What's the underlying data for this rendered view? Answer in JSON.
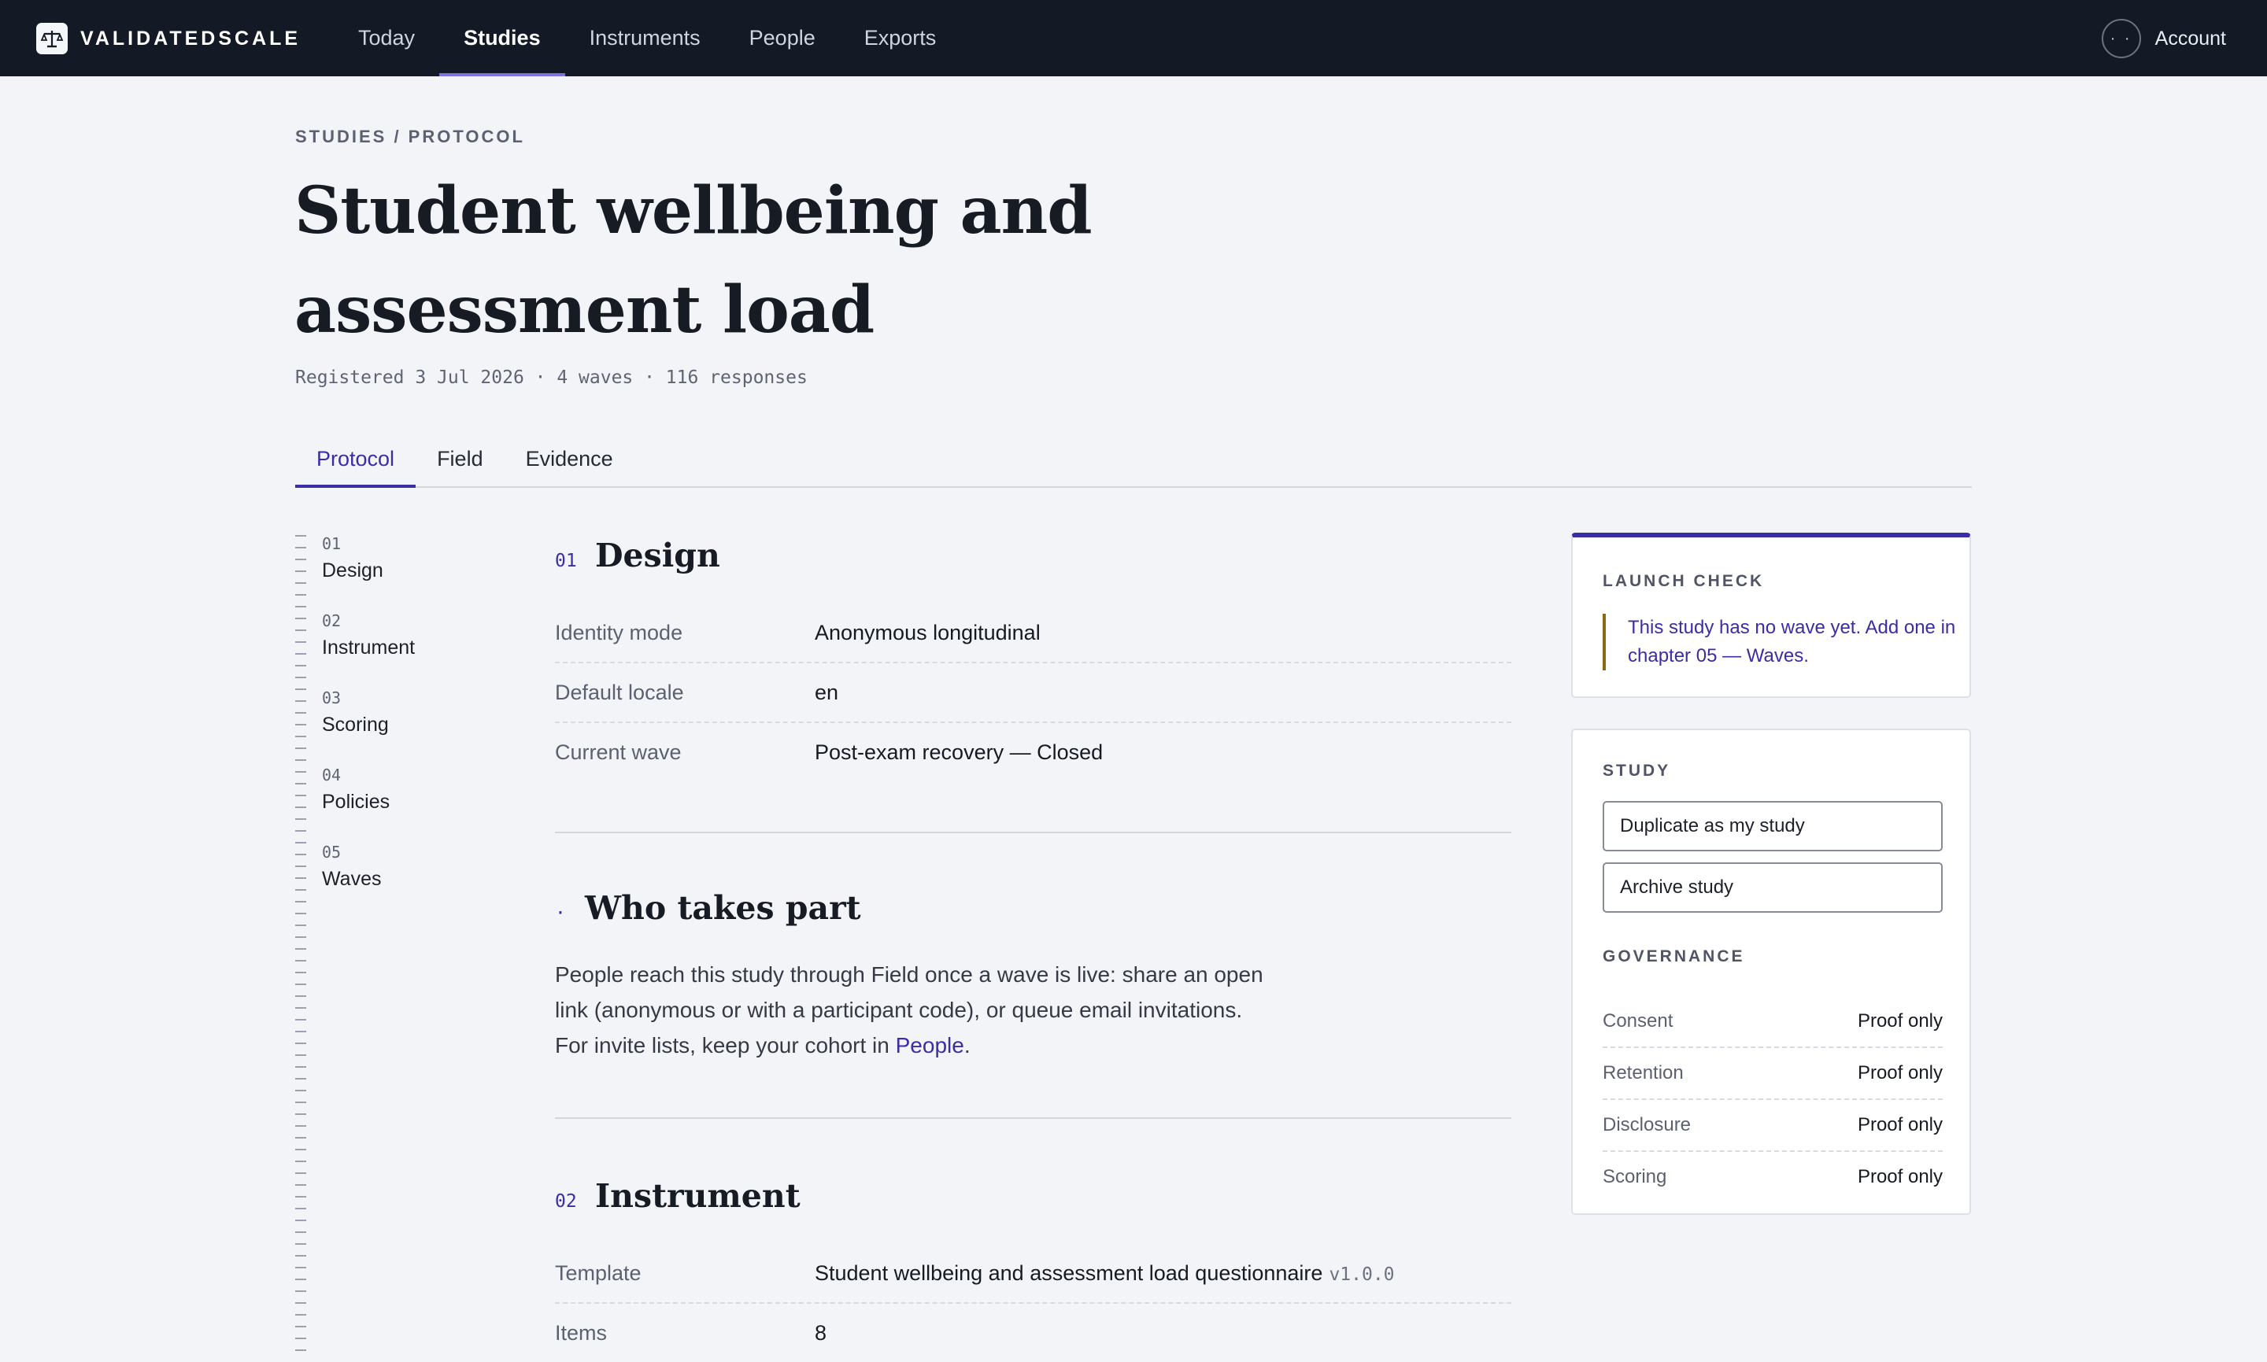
{
  "brand": {
    "name": "VALIDATEDSCALE",
    "logo_icon": "scales-icon"
  },
  "nav": [
    {
      "label": "Today",
      "active": false
    },
    {
      "label": "Studies",
      "active": true
    },
    {
      "label": "Instruments",
      "active": false
    },
    {
      "label": "People",
      "active": false
    },
    {
      "label": "Exports",
      "active": false
    }
  ],
  "account": {
    "label": "Account",
    "avatar_glyph": "· ·"
  },
  "breadcrumb": "STUDIES / PROTOCOL",
  "title": "Student wellbeing and assessment load",
  "meta": "Registered 3 Jul 2026 · 4 waves · 116 responses",
  "tabs": [
    {
      "label": "Protocol",
      "active": true
    },
    {
      "label": "Field",
      "active": false
    },
    {
      "label": "Evidence",
      "active": false
    }
  ],
  "chapters": [
    {
      "num": "01",
      "label": "Design"
    },
    {
      "num": "02",
      "label": "Instrument"
    },
    {
      "num": "03",
      "label": "Scoring"
    },
    {
      "num": "04",
      "label": "Policies"
    },
    {
      "num": "05",
      "label": "Waves"
    }
  ],
  "design": {
    "num": "01",
    "title": "Design",
    "rows": [
      {
        "key": "Identity mode",
        "value": "Anonymous longitudinal"
      },
      {
        "key": "Default locale",
        "value": "en"
      },
      {
        "key": "Current wave",
        "value": "Post-exam recovery — Closed"
      }
    ]
  },
  "who": {
    "marker": "·",
    "title": "Who takes part",
    "text_before": "People reach this study through Field once a wave is live: share an open link (anonymous or with a participant code), or queue email invitations. For invite lists, keep your cohort in ",
    "link": "People",
    "text_after": "."
  },
  "instrument": {
    "num": "02",
    "title": "Instrument",
    "template_key": "Template",
    "template_value": "Student wellbeing and assessment load questionnaire",
    "template_version": "v1.0.0",
    "items_key": "Items",
    "items_value": "8"
  },
  "launch_check": {
    "label": "LAUNCH CHECK",
    "note": "This study has no wave yet. Add one in chapter 05 — Waves."
  },
  "study_card": {
    "label": "STUDY",
    "duplicate_label": "Duplicate as my study",
    "archive_label": "Archive study",
    "governance_label": "GOVERNANCE",
    "governance": [
      {
        "key": "Consent",
        "value": "Proof only"
      },
      {
        "key": "Retention",
        "value": "Proof only"
      },
      {
        "key": "Disclosure",
        "value": "Proof only"
      },
      {
        "key": "Scoring",
        "value": "Proof only"
      }
    ]
  },
  "colors": {
    "topbar": "#141a25",
    "accent": "#3b2da4",
    "background": "#f2f4f8",
    "note_border": "#8a6b14"
  }
}
